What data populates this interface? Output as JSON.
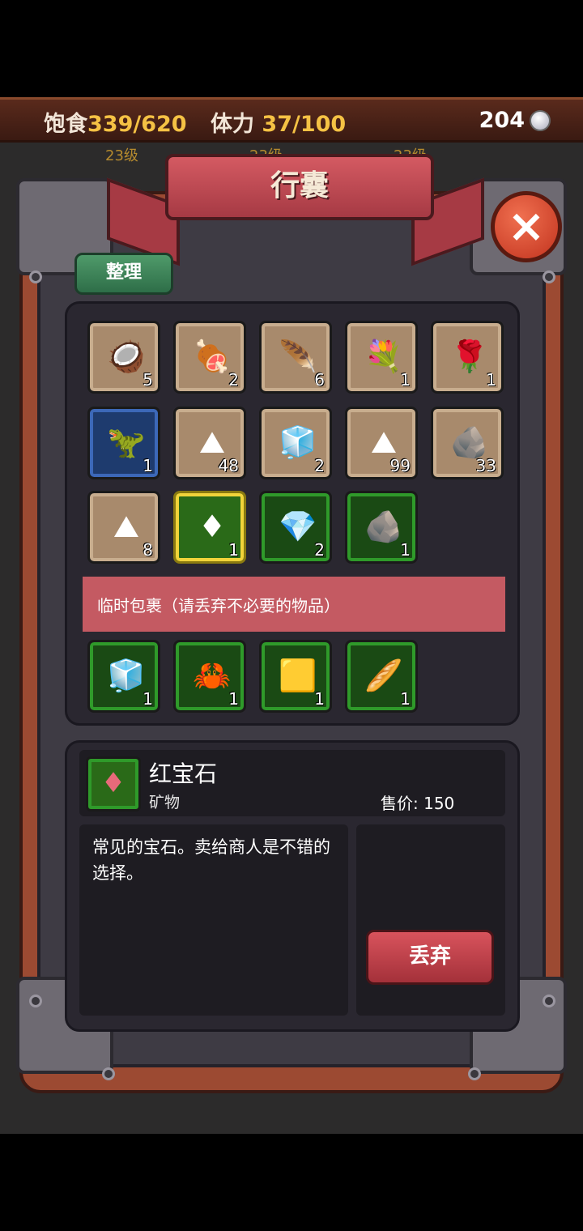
{
  "status": {
    "food_label": "饱食",
    "food_value": "339/620",
    "stamina_label": "体力",
    "stamina_value": "37/100",
    "coins": "204"
  },
  "background": {
    "levels": [
      "23级",
      "23级",
      "23级"
    ]
  },
  "panel": {
    "title": "行囊",
    "sort_label": "整理",
    "temp_label": "临时包裹（请丢弃不必要的物品）"
  },
  "inventory": [
    {
      "icon": "coconut-icon",
      "glyph": "🥥",
      "count": "5",
      "style": "normal"
    },
    {
      "icon": "meat-icon",
      "glyph": "🍖",
      "count": "2",
      "style": "normal"
    },
    {
      "icon": "blue-feather-icon",
      "glyph": "🪶",
      "count": "6",
      "style": "normal"
    },
    {
      "icon": "lily-flower-icon",
      "glyph": "💐",
      "count": "1",
      "style": "normal"
    },
    {
      "icon": "red-rose-icon",
      "glyph": "🌹",
      "count": "1",
      "style": "normal"
    },
    {
      "icon": "green-claw-icon",
      "glyph": "🦖",
      "count": "1",
      "style": "blue"
    },
    {
      "icon": "pink-powder-icon",
      "glyph": "⛰",
      "count": "48",
      "style": "normal"
    },
    {
      "icon": "white-block-icon",
      "glyph": "🧊",
      "count": "2",
      "style": "normal"
    },
    {
      "icon": "green-powder-icon",
      "glyph": "⛰",
      "count": "99",
      "style": "normal"
    },
    {
      "icon": "stone-shards-icon",
      "glyph": "🪨",
      "count": "33",
      "style": "normal"
    },
    {
      "icon": "green-powder-icon",
      "glyph": "⛰",
      "count": "8",
      "style": "normal"
    },
    {
      "icon": "ruby-icon",
      "glyph": "♦",
      "count": "1",
      "style": "selected"
    },
    {
      "icon": "emerald-icon",
      "glyph": "💎",
      "count": "2",
      "style": "green"
    },
    {
      "icon": "gold-ore-icon",
      "glyph": "🪨",
      "count": "1",
      "style": "green"
    }
  ],
  "temp_items": [
    {
      "icon": "white-block-icon",
      "glyph": "🧊",
      "count": "1"
    },
    {
      "icon": "amber-claw-icon",
      "glyph": "🦀",
      "count": "1"
    },
    {
      "icon": "gold-nugget-icon",
      "glyph": "🟨",
      "count": "1"
    },
    {
      "icon": "bread-icon",
      "glyph": "🥖",
      "count": "1"
    }
  ],
  "detail": {
    "name": "红宝石",
    "category": "矿物",
    "price_label": "售价: 150",
    "description": "常见的宝石。卖给商人是不错的选择。",
    "discard_label": "丢弃",
    "glyph": "♦"
  }
}
